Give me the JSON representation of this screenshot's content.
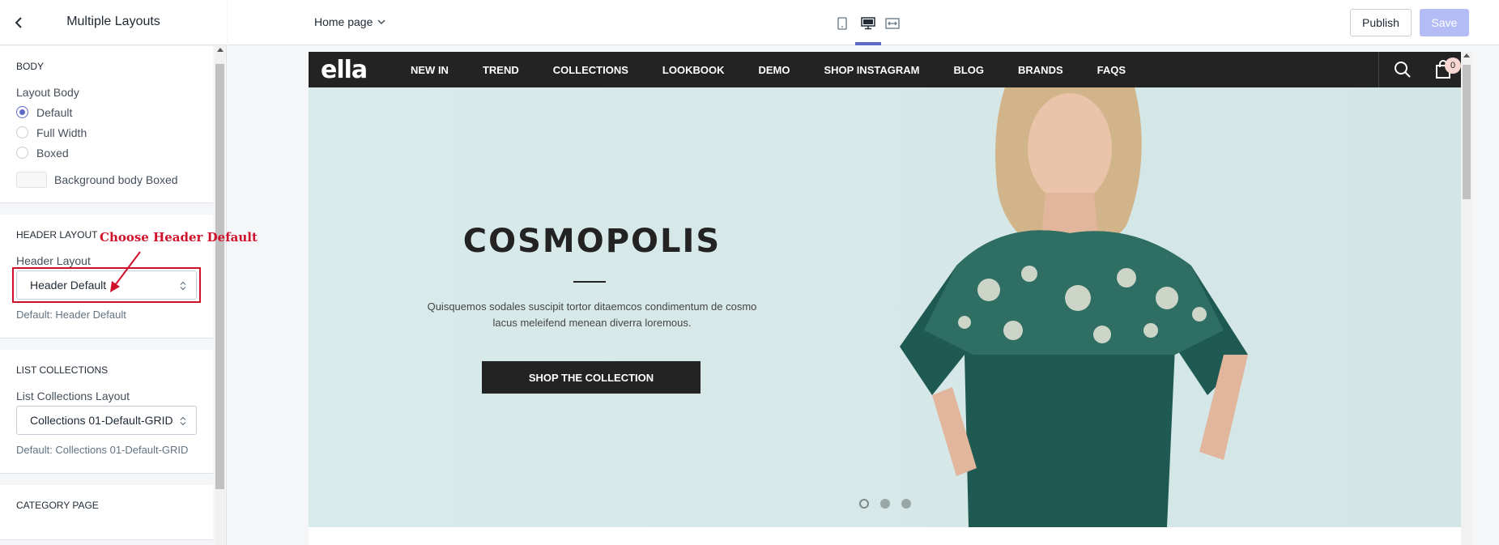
{
  "sidebar": {
    "title": "Multiple Layouts",
    "sections": {
      "body": {
        "title": "BODY",
        "layout_label": "Layout Body",
        "options": [
          "Default",
          "Full Width",
          "Boxed"
        ],
        "selected": "Default",
        "bg_label": "Background body Boxed"
      },
      "header": {
        "title": "HEADER LAYOUT",
        "field_label": "Header Layout",
        "value": "Header Default",
        "help": "Default: Header Default"
      },
      "collections": {
        "title": "LIST COLLECTIONS",
        "field_label": "List Collections Layout",
        "value": "Collections 01-Default-GRID",
        "help": "Default: Collections 01-Default-GRID"
      },
      "category": {
        "title": "CATEGORY PAGE"
      }
    }
  },
  "annotation": {
    "text": "Choose Header Default",
    "color": "#d0112b"
  },
  "topbar": {
    "page_select": "Home page",
    "publish": "Publish",
    "save": "Save",
    "views": [
      "mobile-view-icon",
      "desktop-view-icon",
      "full-width-view-icon"
    ]
  },
  "store": {
    "logo": "ella",
    "nav": [
      "NEW IN",
      "TREND",
      "COLLECTIONS",
      "LOOKBOOK",
      "DEMO",
      "SHOP INSTAGRAM",
      "BLOG",
      "BRANDS",
      "FAQS"
    ],
    "cart_count": "0"
  },
  "hero": {
    "title": "COSMOPOLIS",
    "text": "Quisquemos sodales suscipit tortor ditaemcos condimentum de cosmo lacus meleifend menean diverra loremous.",
    "button": "SHOP THE COLLECTION",
    "slides": 3
  },
  "colors": {
    "accent": "#5c6ac4",
    "save_disabled": "#b3bcf5",
    "annotation": "#d0112b",
    "store_nav": "#232323"
  }
}
